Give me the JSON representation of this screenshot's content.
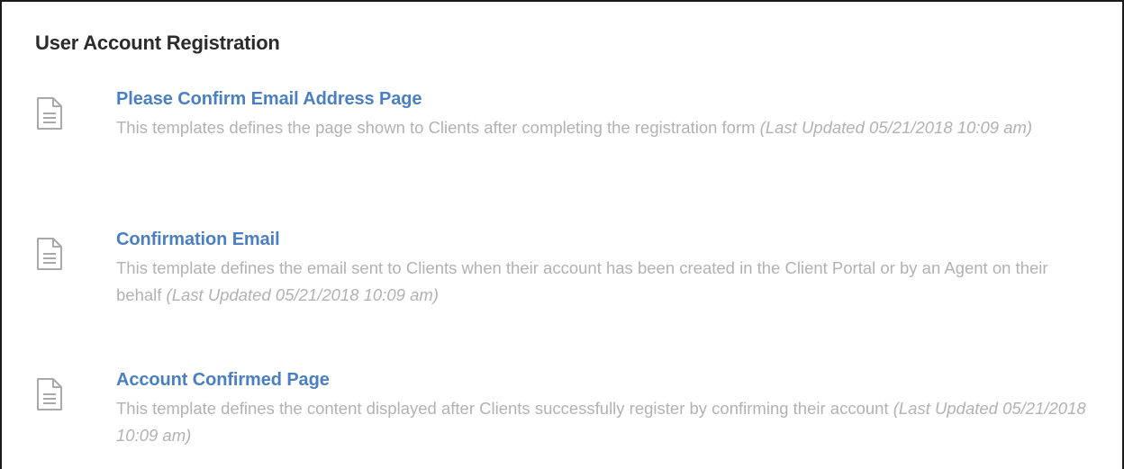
{
  "section": {
    "title": "User Account Registration"
  },
  "templates": [
    {
      "title": "Please Confirm Email Address Page",
      "description": "This templates defines the page shown to Clients after completing the registration form",
      "updated": "(Last Updated 05/21/2018 10:09 am)",
      "icon": "document-icon"
    },
    {
      "title": "Confirmation Email",
      "description": "This template defines the email sent to Clients when their account has been created in the Client Portal or by an Agent on their behalf",
      "updated": "(Last Updated 05/21/2018 10:09 am)",
      "icon": "document-icon"
    },
    {
      "title": "Account Confirmed Page",
      "description": "This template defines the content displayed after Clients successfully register by confirming their account",
      "updated": "(Last Updated 05/21/2018 10:09 am)",
      "icon": "document-icon"
    }
  ],
  "colors": {
    "link": "#4a7fc1",
    "description": "#b2b2b2",
    "heading": "#2b2b2b",
    "icon": "#a9a9a9"
  }
}
